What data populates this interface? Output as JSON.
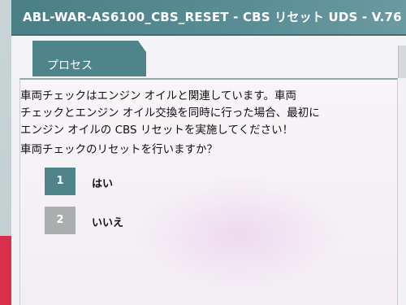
{
  "window": {
    "title": "ABL-WAR-AS6100_CBS_RESET - CBS リセット UDS - V.76"
  },
  "tabs": [
    {
      "label": "プロセス"
    }
  ],
  "main": {
    "body_lines": [
      "車両チェックはエンジン オイルと関連しています。車両",
      "チェックとエンジン オイル交換を同時に行った場合、最初に",
      "エンジン オイルの CBS リセットを実施してください！"
    ],
    "question": "車両チェックのリセットを行いますか？",
    "options": [
      {
        "number": "1",
        "label": "はい"
      },
      {
        "number": "2",
        "label": "いいえ"
      }
    ]
  },
  "colors": {
    "accent": "#4f848b",
    "disabled_option": "#a9aeaf",
    "desk_red": "#d8304a"
  }
}
